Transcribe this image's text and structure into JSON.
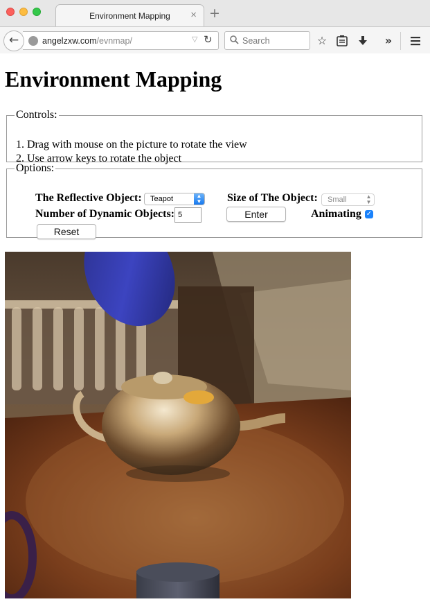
{
  "browser": {
    "tab_title": "Environment Mapping",
    "tab_close": "×",
    "new_tab": "+",
    "url_domain": "angelzxw.com",
    "url_path": "/evnmap/",
    "search_placeholder": "Search",
    "icons": [
      "back-arrow-icon",
      "globe-icon",
      "dropdown-icon",
      "reload-icon",
      "search-icon",
      "bookmark-star-icon",
      "reading-list-icon",
      "download-icon",
      "overflow-chevron-icon",
      "hamburger-menu-icon"
    ]
  },
  "page": {
    "title": "Environment Mapping",
    "controls": {
      "legend": "Controls:",
      "items": [
        "1. Drag with mouse on the picture to rotate the view",
        "2. Use arrow keys to rotate the object"
      ]
    },
    "options": {
      "legend": "Options:",
      "reflective_label": "The Reflective Object:",
      "reflective_value": "Teapot",
      "size_label": "Size of The Object:",
      "size_value": "Small",
      "dynamic_label": "Number of Dynamic Objects:",
      "dynamic_value": "5",
      "enter_label": "Enter",
      "animating_label": "Animating",
      "animating_checked": true,
      "reset_label": "Reset"
    },
    "colors": {
      "checkbox": "#1a82fb",
      "select_accent": "#1779ef",
      "blue_cone": "#2a33a8",
      "teapot": "#b89a6a",
      "floor": "#8a4a22"
    }
  }
}
